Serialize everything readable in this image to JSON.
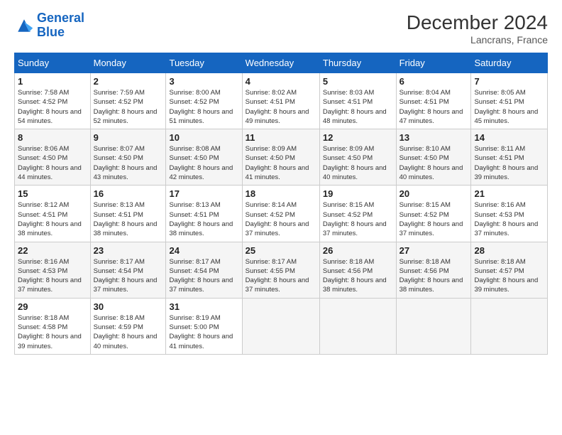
{
  "logo": {
    "line1": "General",
    "line2": "Blue"
  },
  "title": "December 2024",
  "subtitle": "Lancrans, France",
  "days_header": [
    "Sunday",
    "Monday",
    "Tuesday",
    "Wednesday",
    "Thursday",
    "Friday",
    "Saturday"
  ],
  "weeks": [
    [
      {
        "num": "1",
        "sunrise": "7:58 AM",
        "sunset": "4:52 PM",
        "daylight": "8 hours and 54 minutes."
      },
      {
        "num": "2",
        "sunrise": "7:59 AM",
        "sunset": "4:52 PM",
        "daylight": "8 hours and 52 minutes."
      },
      {
        "num": "3",
        "sunrise": "8:00 AM",
        "sunset": "4:52 PM",
        "daylight": "8 hours and 51 minutes."
      },
      {
        "num": "4",
        "sunrise": "8:02 AM",
        "sunset": "4:51 PM",
        "daylight": "8 hours and 49 minutes."
      },
      {
        "num": "5",
        "sunrise": "8:03 AM",
        "sunset": "4:51 PM",
        "daylight": "8 hours and 48 minutes."
      },
      {
        "num": "6",
        "sunrise": "8:04 AM",
        "sunset": "4:51 PM",
        "daylight": "8 hours and 47 minutes."
      },
      {
        "num": "7",
        "sunrise": "8:05 AM",
        "sunset": "4:51 PM",
        "daylight": "8 hours and 45 minutes."
      }
    ],
    [
      {
        "num": "8",
        "sunrise": "8:06 AM",
        "sunset": "4:50 PM",
        "daylight": "8 hours and 44 minutes."
      },
      {
        "num": "9",
        "sunrise": "8:07 AM",
        "sunset": "4:50 PM",
        "daylight": "8 hours and 43 minutes."
      },
      {
        "num": "10",
        "sunrise": "8:08 AM",
        "sunset": "4:50 PM",
        "daylight": "8 hours and 42 minutes."
      },
      {
        "num": "11",
        "sunrise": "8:09 AM",
        "sunset": "4:50 PM",
        "daylight": "8 hours and 41 minutes."
      },
      {
        "num": "12",
        "sunrise": "8:09 AM",
        "sunset": "4:50 PM",
        "daylight": "8 hours and 40 minutes."
      },
      {
        "num": "13",
        "sunrise": "8:10 AM",
        "sunset": "4:50 PM",
        "daylight": "8 hours and 40 minutes."
      },
      {
        "num": "14",
        "sunrise": "8:11 AM",
        "sunset": "4:51 PM",
        "daylight": "8 hours and 39 minutes."
      }
    ],
    [
      {
        "num": "15",
        "sunrise": "8:12 AM",
        "sunset": "4:51 PM",
        "daylight": "8 hours and 38 minutes."
      },
      {
        "num": "16",
        "sunrise": "8:13 AM",
        "sunset": "4:51 PM",
        "daylight": "8 hours and 38 minutes."
      },
      {
        "num": "17",
        "sunrise": "8:13 AM",
        "sunset": "4:51 PM",
        "daylight": "8 hours and 38 minutes."
      },
      {
        "num": "18",
        "sunrise": "8:14 AM",
        "sunset": "4:52 PM",
        "daylight": "8 hours and 37 minutes."
      },
      {
        "num": "19",
        "sunrise": "8:15 AM",
        "sunset": "4:52 PM",
        "daylight": "8 hours and 37 minutes."
      },
      {
        "num": "20",
        "sunrise": "8:15 AM",
        "sunset": "4:52 PM",
        "daylight": "8 hours and 37 minutes."
      },
      {
        "num": "21",
        "sunrise": "8:16 AM",
        "sunset": "4:53 PM",
        "daylight": "8 hours and 37 minutes."
      }
    ],
    [
      {
        "num": "22",
        "sunrise": "8:16 AM",
        "sunset": "4:53 PM",
        "daylight": "8 hours and 37 minutes."
      },
      {
        "num": "23",
        "sunrise": "8:17 AM",
        "sunset": "4:54 PM",
        "daylight": "8 hours and 37 minutes."
      },
      {
        "num": "24",
        "sunrise": "8:17 AM",
        "sunset": "4:54 PM",
        "daylight": "8 hours and 37 minutes."
      },
      {
        "num": "25",
        "sunrise": "8:17 AM",
        "sunset": "4:55 PM",
        "daylight": "8 hours and 37 minutes."
      },
      {
        "num": "26",
        "sunrise": "8:18 AM",
        "sunset": "4:56 PM",
        "daylight": "8 hours and 38 minutes."
      },
      {
        "num": "27",
        "sunrise": "8:18 AM",
        "sunset": "4:56 PM",
        "daylight": "8 hours and 38 minutes."
      },
      {
        "num": "28",
        "sunrise": "8:18 AM",
        "sunset": "4:57 PM",
        "daylight": "8 hours and 39 minutes."
      }
    ],
    [
      {
        "num": "29",
        "sunrise": "8:18 AM",
        "sunset": "4:58 PM",
        "daylight": "8 hours and 39 minutes."
      },
      {
        "num": "30",
        "sunrise": "8:18 AM",
        "sunset": "4:59 PM",
        "daylight": "8 hours and 40 minutes."
      },
      {
        "num": "31",
        "sunrise": "8:19 AM",
        "sunset": "5:00 PM",
        "daylight": "8 hours and 41 minutes."
      },
      null,
      null,
      null,
      null
    ]
  ],
  "labels": {
    "sunrise": "Sunrise:",
    "sunset": "Sunset:",
    "daylight": "Daylight:"
  }
}
